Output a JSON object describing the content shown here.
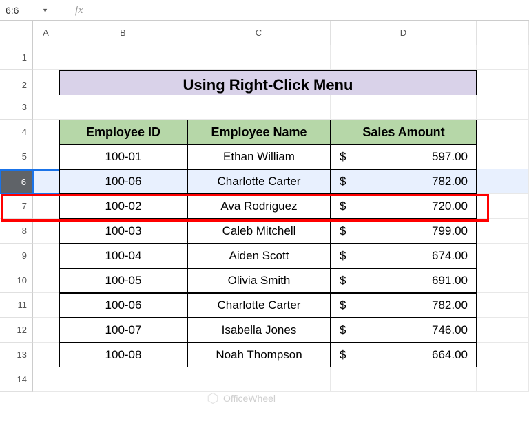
{
  "nameBox": "6:6",
  "fxLabel": "fx",
  "formula": "",
  "columns": [
    "A",
    "B",
    "C",
    "D"
  ],
  "rows": [
    "1",
    "2",
    "3",
    "4",
    "5",
    "6",
    "7",
    "8",
    "9",
    "10",
    "11",
    "12",
    "13",
    "14"
  ],
  "selectedRow": 6,
  "title": "Using Right-Click Menu",
  "headers": {
    "id": "Employee ID",
    "name": "Employee Name",
    "sales": "Sales Amount"
  },
  "currency": "$",
  "data": [
    {
      "id": "100-01",
      "name": "Ethan William",
      "amount": "597.00"
    },
    {
      "id": "100-06",
      "name": "Charlotte Carter",
      "amount": "782.00"
    },
    {
      "id": "100-02",
      "name": "Ava Rodriguez",
      "amount": "720.00"
    },
    {
      "id": "100-03",
      "name": "Caleb Mitchell",
      "amount": "799.00"
    },
    {
      "id": "100-04",
      "name": "Aiden Scott",
      "amount": "674.00"
    },
    {
      "id": "100-05",
      "name": "Olivia Smith",
      "amount": "691.00"
    },
    {
      "id": "100-06",
      "name": "Charlotte Carter",
      "amount": "782.00"
    },
    {
      "id": "100-07",
      "name": "Isabella Jones",
      "amount": "746.00"
    },
    {
      "id": "100-08",
      "name": "Noah Thompson",
      "amount": "664.00"
    }
  ],
  "watermark": "OfficeWheel"
}
